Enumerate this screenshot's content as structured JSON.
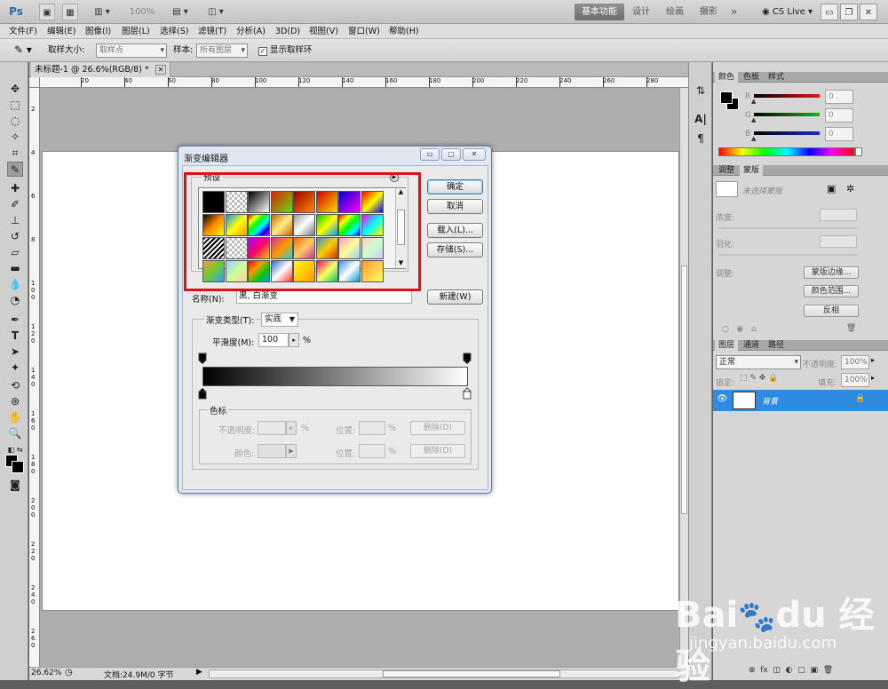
{
  "topbar": {
    "logo": "Ps",
    "zoom": "100%",
    "workspaces": [
      "基本功能",
      "设计",
      "绘画",
      "摄影"
    ],
    "more": "»",
    "cslive": "CS Live"
  },
  "menu": [
    "文件(F)",
    "编辑(E)",
    "图像(I)",
    "图层(L)",
    "选择(S)",
    "滤镜(T)",
    "分析(A)",
    "3D(D)",
    "视图(V)",
    "窗口(W)",
    "帮助(H)"
  ],
  "options": {
    "sample_size_label": "取样大小:",
    "sample_size_value": "取样点",
    "sample_label": "样本:",
    "sample_value": "所有图层",
    "show_ring": "显示取样环"
  },
  "document": {
    "tab_title": "未标题-1 @ 26.6%(RGB/8) *",
    "ruler_h": [
      "20",
      "40",
      "60",
      "80",
      "100",
      "120",
      "140",
      "160",
      "180",
      "200",
      "220",
      "240",
      "260",
      "280"
    ],
    "ruler_v": [
      "2",
      "4",
      "6",
      "8",
      "1\n0\n0",
      "1\n2\n0",
      "1\n4\n0",
      "1\n6\n0",
      "1\n8\n0",
      "2\n0\n0",
      "2\n2\n0",
      "2\n4\n0",
      "2\n6\n0"
    ],
    "zoom": "26.62%",
    "status": "文档:24.9M/0 字节"
  },
  "panels": {
    "color_tabs": [
      "颜色",
      "色板",
      "样式"
    ],
    "color_channels": [
      {
        "label": "R",
        "value": "0",
        "color": "#e01919"
      },
      {
        "label": "G",
        "value": "0",
        "color": "#1eb41e"
      },
      {
        "label": "B",
        "value": "0",
        "color": "#1c2bd4"
      }
    ],
    "adjust_tabs": [
      "调整",
      "蒙版"
    ],
    "mask_none": "未选择蒙版",
    "density_label": "浓度:",
    "feather_label": "羽化:",
    "refine_label": "调整:",
    "mask_edge": "蒙版边缘...",
    "color_range": "颜色范围...",
    "invert": "反相",
    "layers_tabs": [
      "图层",
      "通道",
      "路径"
    ],
    "blend_mode": "正常",
    "opacity_label": "不透明度:",
    "opacity_value": "100%",
    "lock_label": "锁定:",
    "fill_label": "填充:",
    "fill_value": "100%",
    "layer_name": "背景"
  },
  "dialog": {
    "title": "渐变编辑器",
    "presets_label": "预设",
    "ok": "确定",
    "cancel": "取消",
    "load": "载入(L)...",
    "save": "存储(S)...",
    "name_label": "名称(N):",
    "name_value": "黑, 白渐变",
    "new": "新建(W)",
    "type_label": "渐变类型(T):",
    "type_value": "实底",
    "smooth_label": "平滑度(M):",
    "smooth_value": "100",
    "percent": "%",
    "stops_label": "色标",
    "opacity_label": "不透明度:",
    "color_label": "颜色:",
    "location_label": "位置:",
    "delete_label": "删除(D)",
    "presets": [
      {
        "css": "linear-gradient(90deg,#000,#000)"
      },
      {
        "css": "repeating-conic-gradient(#bbb 0 25%,#fff 0 50%) 0 0/6px 6px"
      },
      {
        "css": "linear-gradient(135deg,#000,#fff)"
      },
      {
        "css": "linear-gradient(135deg,#d21,#6d0)"
      },
      {
        "css": "linear-gradient(135deg,#900,#f80)"
      },
      {
        "css": "linear-gradient(135deg,#c00,#fd0)"
      },
      {
        "css": "linear-gradient(135deg,#00c,#f0f)"
      },
      {
        "css": "linear-gradient(135deg,#f00,#ff0,#00f)"
      },
      {
        "css": "linear-gradient(135deg,#000,#f80,#ff0)"
      },
      {
        "css": "linear-gradient(135deg,#09f,#ff0,#f90)"
      },
      {
        "css": "linear-gradient(135deg,#f00,#ff0,#0f0,#0ff,#00f,#f0f)"
      },
      {
        "css": "linear-gradient(135deg,#c60,#fe8,#c60)"
      },
      {
        "css": "linear-gradient(135deg,#999,#fff,#777)"
      },
      {
        "css": "linear-gradient(135deg,#0c0,#ff0,#09f)"
      },
      {
        "css": "linear-gradient(135deg,#f00,#ff0,#0f0,#0ff,#00f)"
      },
      {
        "css": "linear-gradient(135deg,#f0f,#0ff,#ff0)"
      },
      {
        "css": "repeating-linear-gradient(135deg,#000 0 2px,#fff 2px 4px)"
      },
      {
        "css": "repeating-conic-gradient(#bbb 0 25%,#fff 0 50%) 0 0/6px 6px"
      },
      {
        "css": "linear-gradient(135deg,#a0f,#f06,#fc0)"
      },
      {
        "css": "linear-gradient(135deg,#c39,#f90,#3cc)"
      },
      {
        "css": "linear-gradient(135deg,#f60,#fc6,#c39)"
      },
      {
        "css": "linear-gradient(135deg,#39c,#fc0,#c30)"
      },
      {
        "css": "linear-gradient(135deg,#f9c,#ff9,#9cf)"
      },
      {
        "css": "linear-gradient(135deg,#fcc,#cfc,#ccf)"
      },
      {
        "css": "linear-gradient(135deg,#f93,#6c3,#39f)"
      },
      {
        "css": "linear-gradient(135deg,#9cf,#cf9,#fc9)"
      },
      {
        "css": "linear-gradient(135deg,#f00,#f90,#0c0,#09f)"
      },
      {
        "css": "linear-gradient(135deg,#36c,#fff,#f33)"
      },
      {
        "css": "linear-gradient(135deg,#ff0,#fc0,#f90)"
      },
      {
        "css": "linear-gradient(135deg,#f06,#ff6,#0c6)"
      },
      {
        "css": "linear-gradient(135deg,#39f,#fff,#09c)"
      },
      {
        "css": "linear-gradient(135deg,#f93,#ff6)"
      }
    ]
  }
}
